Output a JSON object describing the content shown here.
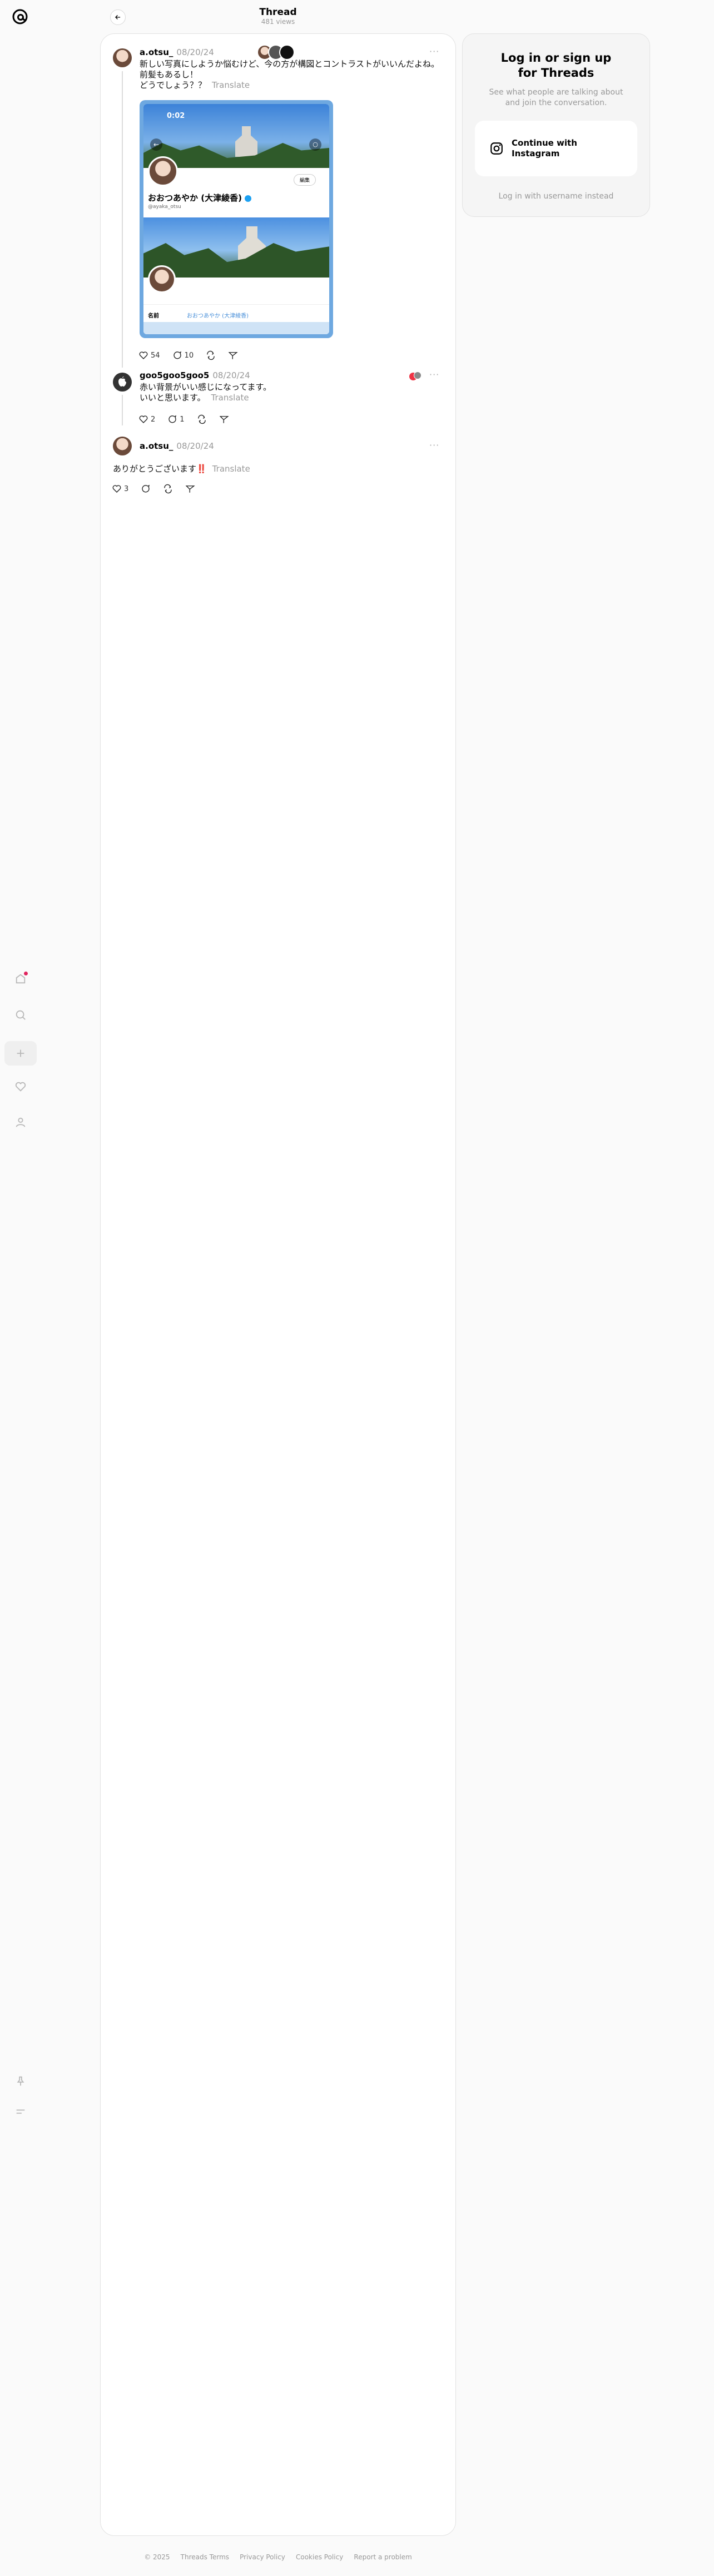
{
  "header": {
    "title": "Thread",
    "views": "481 views"
  },
  "colors": {
    "accent_blue": "#4a90d9",
    "text_muted": "#999999",
    "notification_dot": "#e0245e"
  },
  "rail_icons": [
    "threads-logo-icon",
    "home-icon",
    "search-icon",
    "plus-icon",
    "heart-icon",
    "profile-icon",
    "pin-icon",
    "menu-icon"
  ],
  "posts": [
    {
      "username": "a.otsu_",
      "date": "08/20/24",
      "line1": "新しい写真にしようか悩むけど、今の方が構図とコントラストがいいんだよね。",
      "line2": "前髪もあるし！",
      "line3": "どうでしょう？？",
      "translate": "Translate",
      "likes": "54",
      "replies": "10"
    },
    {
      "username": "goo5goo5goo5",
      "date": "08/20/24",
      "line1": "赤い背景がいい感じになってます。",
      "line2": "いいと思います。",
      "translate": "Translate",
      "likes": "2",
      "replies": "1"
    },
    {
      "username": "a.otsu_",
      "date": "08/20/24",
      "line1": "ありがとうございます‼️",
      "translate": "Translate",
      "likes": "3"
    }
  ],
  "screenshot": {
    "time": "0:02",
    "edit_label": "編集",
    "display_name": "おおつあやか (大津綾香)",
    "handle": "@ayaka_otsu",
    "name_label": "名前",
    "name_value": "おおつあやか (大津綾香)"
  },
  "login": {
    "title_line1": "Log in or sign up",
    "title_line2": "for Threads",
    "subtitle_line1": "See what people are talking about",
    "subtitle_line2": "and join the conversation.",
    "continue_line1": "Continue with",
    "continue_line2": "Instagram",
    "username_login": "Log in with username instead"
  },
  "footer": {
    "copyright": "© 2025",
    "terms": "Threads Terms",
    "privacy": "Privacy Policy",
    "cookies": "Cookies Policy",
    "report": "Report a problem"
  }
}
